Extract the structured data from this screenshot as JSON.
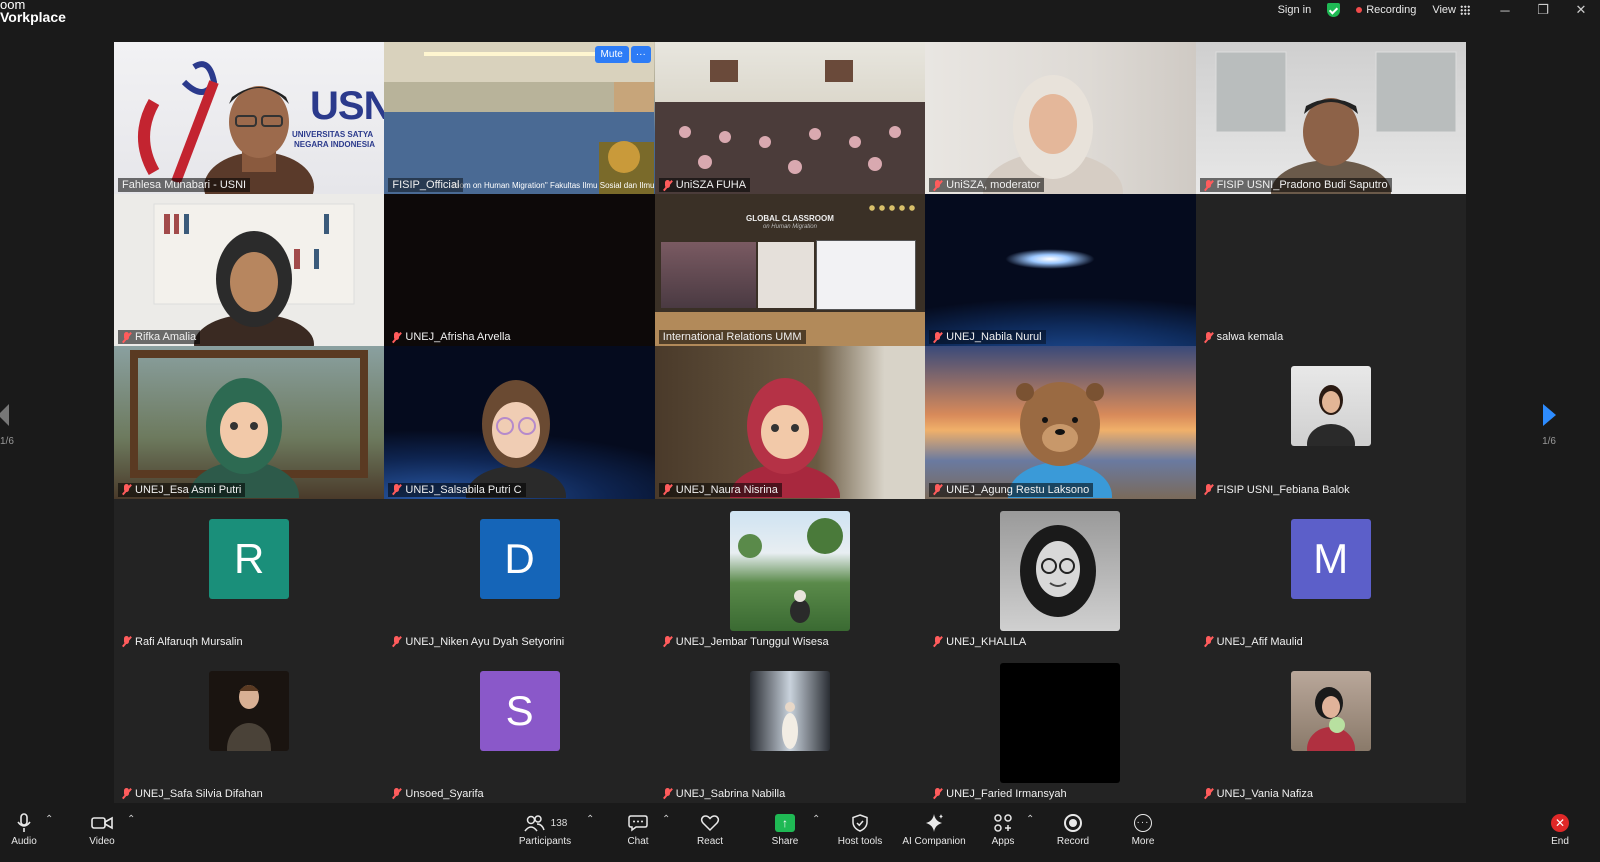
{
  "app": {
    "brand_line1": "oom",
    "brand_line2": "Vorkplace"
  },
  "titlebar": {
    "sign_in": "Sign in",
    "recording": "Recording",
    "view": "View",
    "minimize": "─",
    "restore": "❐",
    "close": "✕",
    "colors": {
      "secure": "#1fb954",
      "record_dot": "#f14b4b"
    }
  },
  "grid": {
    "page_indicator_left": "1/6",
    "page_indicator_right": "1/6",
    "tiles": [
      {
        "name": "Fahlesa Munabari - USNI",
        "muted": false
      },
      {
        "name": "FISIP_Official",
        "muted": false,
        "caption": "room on Human Migration\" Fakultas Ilmu Sosial dan Ilmu I",
        "mute_button": "Mute",
        "more_button": "···"
      },
      {
        "name": "UniSZA FUHA",
        "muted": true
      },
      {
        "name": "UniSZA, moderator",
        "muted": true
      },
      {
        "name": "FISIP USNI_Pradono Budi Saputro",
        "muted": true
      },
      {
        "name": "Rifka Amalia",
        "muted": true
      },
      {
        "name": "UNEJ_Afrisha Arvella",
        "muted": true
      },
      {
        "name": "International Relations UMM",
        "muted": false,
        "slide_title": "GLOBAL CLASSROOM",
        "slide_subtitle": "on Human Migration"
      },
      {
        "name": "UNEJ_Nabila Nurul",
        "muted": true
      },
      {
        "name": "salwa kemala",
        "muted": true
      },
      {
        "name": "UNEJ_Esa Asmi Putri",
        "muted": true
      },
      {
        "name": "UNEJ_Salsabila Putri C",
        "muted": true
      },
      {
        "name": "UNEJ_Naura Nisrina",
        "muted": true
      },
      {
        "name": "UNEJ_Agung Restu Laksono",
        "muted": true
      },
      {
        "name": "FISIP USNI_Febiana Balok",
        "muted": true
      },
      {
        "name": "Rafi Alfaruqh Mursalin",
        "muted": true,
        "letter": "R",
        "color": "#1a8f7a"
      },
      {
        "name": "UNEJ_Niken Ayu Dyah Setyorini",
        "muted": true,
        "letter": "D",
        "color": "#1565b8"
      },
      {
        "name": "UNEJ_Jembar Tunggul Wisesa",
        "muted": true
      },
      {
        "name": "UNEJ_KHALILA",
        "muted": true
      },
      {
        "name": "UNEJ_Afif Maulid",
        "muted": true,
        "letter": "M",
        "color": "#5c5fc9"
      },
      {
        "name": "UNEJ_Safa Silvia Difahan",
        "muted": true
      },
      {
        "name": "Unsoed_Syarifa",
        "muted": true,
        "letter": "S",
        "color": "#8a58c9"
      },
      {
        "name": "UNEJ_Sabrina Nabilla",
        "muted": true
      },
      {
        "name": "UNEJ_Faried Irmansyah",
        "muted": true
      },
      {
        "name": "UNEJ_Vania Nafiza",
        "muted": true
      }
    ],
    "logo_text": "USNI",
    "logo_sub1": "UNIVERSITAS SATYA",
    "logo_sub2": "NEGARA INDONESIA"
  },
  "toolbar": {
    "audio": "Audio",
    "video": "Video",
    "participants": "Participants",
    "participants_count": "138",
    "chat": "Chat",
    "react": "React",
    "share": "Share",
    "host_tools": "Host tools",
    "ai_companion": "AI Companion",
    "apps": "Apps",
    "record": "Record",
    "more": "More",
    "end": "End",
    "caret": "⌃"
  }
}
